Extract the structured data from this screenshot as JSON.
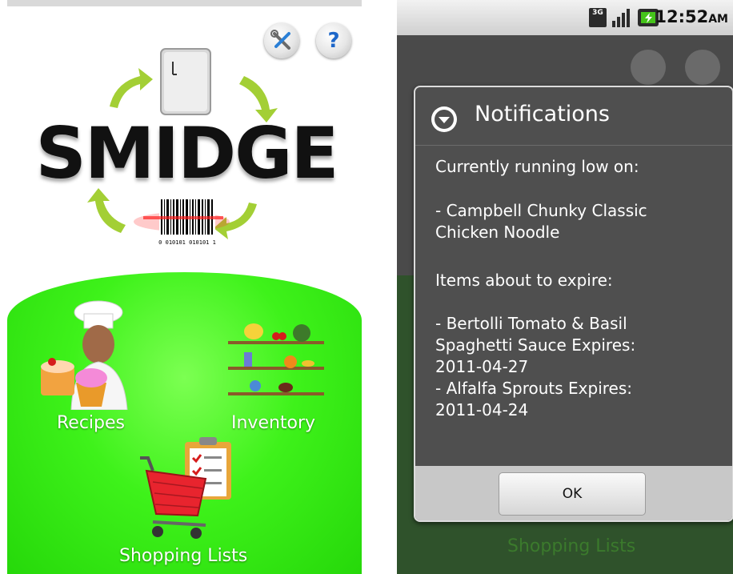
{
  "left_screen": {
    "logo_text": "SMIDGE",
    "barcode_number": "0 010101 010101 1",
    "menu": {
      "recipes": "Recipes",
      "inventory": "Inventory",
      "shopping_lists": "Shopping Lists"
    },
    "icons": [
      "tools-icon",
      "help-icon",
      "refrigerator-icon",
      "barcode-icon",
      "chef-icon",
      "shelves-icon",
      "shopping-cart-icon",
      "clipboard-icon"
    ],
    "help_glyph": "?"
  },
  "right_screen": {
    "status": {
      "network": "3G",
      "time": "12:52",
      "ampm": "AM"
    },
    "dialog": {
      "title": "Notifications",
      "low_header": "Currently running low on:",
      "low_items": [
        "- Campbell Chunky Classic",
        "Chicken Noodle"
      ],
      "expire_header": "Items about to expire:",
      "expire_items": [
        "- Bertolli Tomato & Basil",
        "Spaghetti Sauce  Expires:",
        "2011-04-27",
        "- Alfalfa Sprouts  Expires:",
        "2011-04-24"
      ],
      "ok_label": "OK"
    },
    "background_label": "Shopping Lists"
  },
  "colors": {
    "green": "#3ef21a",
    "dialog_bg": "#4f4f4f",
    "arrow": "#a3cf35",
    "help_blue": "#1e67c9"
  }
}
